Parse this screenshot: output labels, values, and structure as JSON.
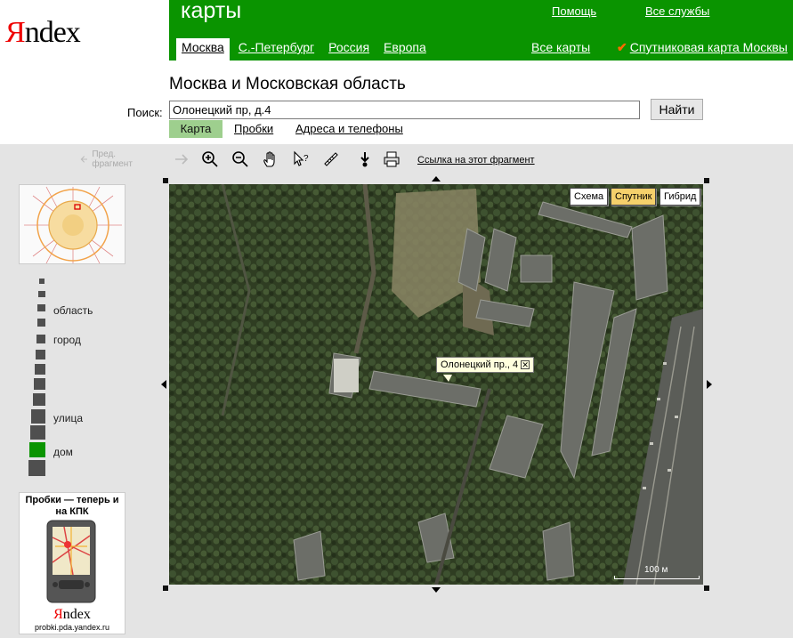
{
  "logo": {
    "first": "Я",
    "rest": "ndex"
  },
  "header": {
    "service_title": "карты",
    "help": "Помощь",
    "all_services": "Все службы",
    "tabs": [
      {
        "label": "Москва",
        "active": true
      },
      {
        "label": "С.-Петербург",
        "active": false
      },
      {
        "label": "Россия",
        "active": false
      },
      {
        "label": "Европа",
        "active": false
      }
    ],
    "all_maps": "Все карты",
    "satellite_map_link": "Спутниковая карта Москвы",
    "region_title": "Москва и Московская область"
  },
  "search": {
    "label": "Поиск:",
    "value": "Олонецкий пр, д.4",
    "button": "Найти"
  },
  "mode_tabs": [
    {
      "label": "Карта",
      "active": true
    },
    {
      "label": "Пробки",
      "active": false
    },
    {
      "label": "Адреса и телефоны",
      "active": false
    }
  ],
  "toolbar": {
    "prev_fragment": "Пред. фрагмент",
    "link_to_fragment": "Ссылка на этот фрагмент",
    "icons": [
      "back-arrow-icon",
      "forward-arrow-icon",
      "zoom-in-icon",
      "zoom-out-icon",
      "hand-icon",
      "info-cursor-icon",
      "ruler-icon",
      "download-icon",
      "print-icon"
    ]
  },
  "map": {
    "types": [
      {
        "label": "Схема",
        "active": false
      },
      {
        "label": "Спутник",
        "active": true
      },
      {
        "label": "Гибрид",
        "active": false
      }
    ],
    "balloon": "Олонецкий пр., 4",
    "scale": "100 м"
  },
  "zoom": {
    "labels": {
      "region": "область",
      "city": "город",
      "street": "улица",
      "house": "дом"
    },
    "current_level_label": "дом"
  },
  "ad": {
    "title": "Пробки — теперь и на КПК",
    "logo_first": "Я",
    "logo_rest": "ndex",
    "url": "probki.pda.yandex.ru"
  },
  "colors": {
    "brand_green": "#0a9400",
    "active_tab_green": "#9ecf8e",
    "balloon_bg": "#ffffdd",
    "active_map_type": "#f5d06b"
  }
}
